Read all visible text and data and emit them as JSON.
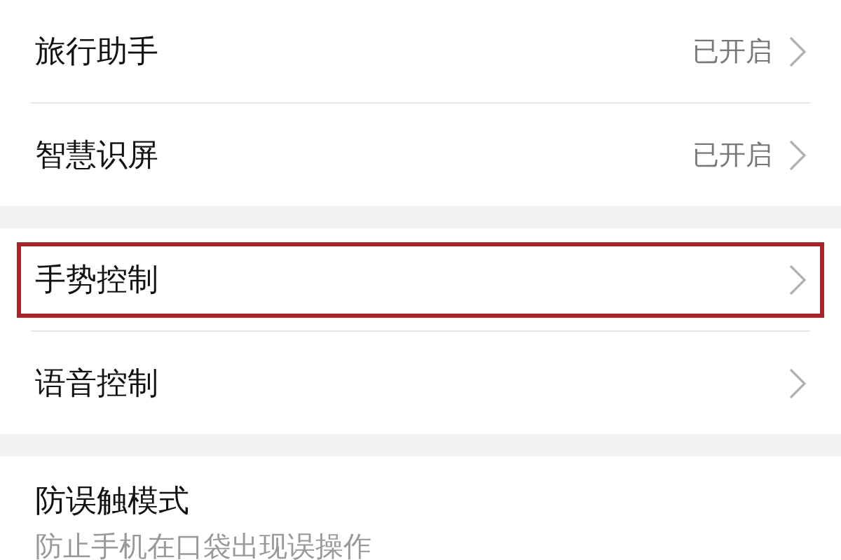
{
  "groups": [
    {
      "items": [
        {
          "title": "旅行助手",
          "value": "已开启",
          "highlighted": false
        },
        {
          "title": "智慧识屏",
          "value": "已开启",
          "highlighted": false
        }
      ]
    },
    {
      "items": [
        {
          "title": "手势控制",
          "highlighted": true
        },
        {
          "title": "语音控制",
          "highlighted": false
        }
      ]
    },
    {
      "items": [
        {
          "title": "防误触模式",
          "subtitle": "防止手机在口袋出现误操作",
          "highlighted": false
        }
      ]
    }
  ]
}
